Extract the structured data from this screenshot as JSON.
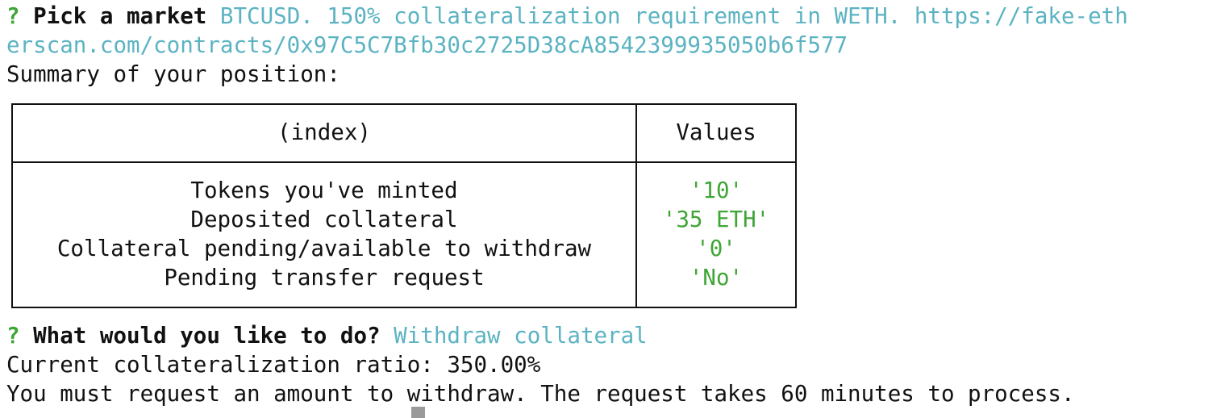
{
  "prompt_marker": "?",
  "pick_market": {
    "label": "Pick a market",
    "answer_line1": "BTCUSD. 150% collateralization requirement in WETH. https://fake-eth",
    "answer_line2": "erscan.com/contracts/0x97C5C7Bfb30c2725D38cA8542399935050b6f577"
  },
  "summary_heading": "Summary of your position:",
  "table": {
    "headers": [
      "(index)",
      "Values"
    ],
    "rows": [
      {
        "label": "Tokens you've minted",
        "value": "'10'"
      },
      {
        "label": "Deposited collateral",
        "value": "'35 ETH'"
      },
      {
        "label": "Collateral pending/available to withdraw",
        "value": "'0'"
      },
      {
        "label": "Pending transfer request",
        "value": "'No'"
      }
    ]
  },
  "action": {
    "label": "What would you like to do?",
    "answer": "Withdraw collateral"
  },
  "ratio_line": "Current collateralization ratio: 350.00%",
  "info_line": "You must request an amount to withdraw. The request takes 60 minutes to process.",
  "colors": {
    "prompt_green": "#3fa535",
    "answer_cyan": "#5bb3c2",
    "text": "#111111"
  }
}
